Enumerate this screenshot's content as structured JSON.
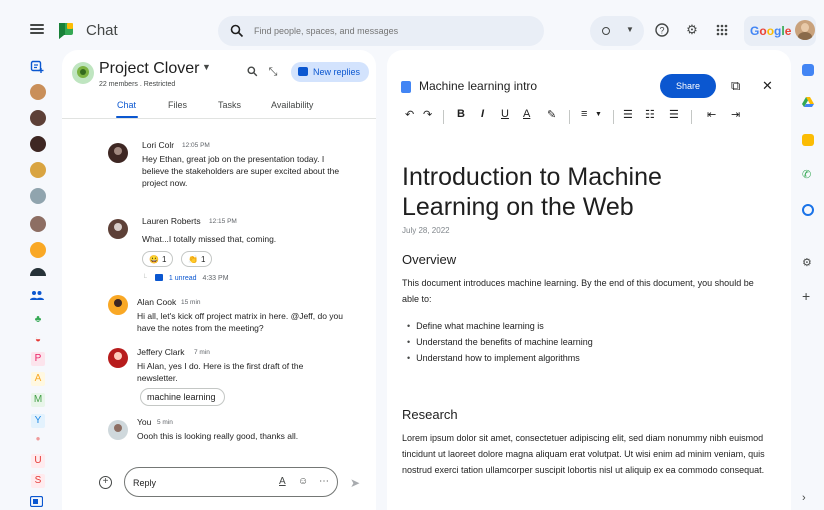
{
  "app": {
    "name": "Chat"
  },
  "search": {
    "placeholder": "Find people, spaces, and messages"
  },
  "account": {
    "brand": "Google"
  },
  "space": {
    "name": "Project Clover",
    "meta": "22 members . Restricted",
    "new_replies": "New replies",
    "tabs": [
      {
        "label": "Chat"
      },
      {
        "label": "Files"
      },
      {
        "label": "Tasks"
      },
      {
        "label": "Availability"
      }
    ]
  },
  "messages": [
    {
      "name": "Lori Colr",
      "time": "12:05 PM",
      "text": "Hey Ethan, great job on the presentation today. I believe the stakeholders are super excited about the project now."
    },
    {
      "name": "Lauren Roberts",
      "time": "12:15 PM",
      "text": "What...I totally missed that, coming.",
      "reactions": [
        {
          "emoji": "😀",
          "count": "1"
        },
        {
          "emoji": "👏",
          "count": "1"
        }
      ],
      "thread": {
        "unread": "1 unread",
        "time": "4:33 PM"
      }
    },
    {
      "name": "Alan Cook",
      "time": "15 min",
      "text": "Hi all, let's kick off project matrix in here. @Jeff, do you have the notes from the meeting?"
    },
    {
      "name": "Jeffery Clark",
      "time": "7 min",
      "text": "Hi Alan, yes I do. Here is the first draft of the newsletter.",
      "chip": "machine learning"
    },
    {
      "name": "You",
      "time": "5 min",
      "text": "Oooh this is looking really good, thanks all."
    }
  ],
  "composer": {
    "value": "Reply"
  },
  "rail_letters": [
    "P",
    "A",
    "M",
    "Y",
    "U",
    "S"
  ],
  "doc": {
    "title": "Machine learning intro",
    "share": "Share",
    "heading": "Introduction to Machine Learning on the Web",
    "date": "July 28, 2022",
    "overview_heading": "Overview",
    "overview_text": "This document introduces machine learning. By the end of this document, you should be able to:",
    "bullets": [
      "Define what machine learning is",
      "Understand the benefits of machine learning",
      "Understand how to implement algorithms"
    ],
    "research_heading": "Research",
    "research_text": "Lorem ipsum dolor sit amet, consectetuer adipiscing elit, sed diam nonummy nibh euismod tincidunt ut laoreet dolore magna aliquam erat volutpat. Ut wisi enim ad minim veniam, quis nostrud exerci tation ullamcorper suscipit lobortis nisl ut aliquip ex ea commodo consequat."
  },
  "colors": {
    "accent": "#0b57d0",
    "chip_bg": "#d3e3fd",
    "page_bg": "#f6f8fc"
  }
}
